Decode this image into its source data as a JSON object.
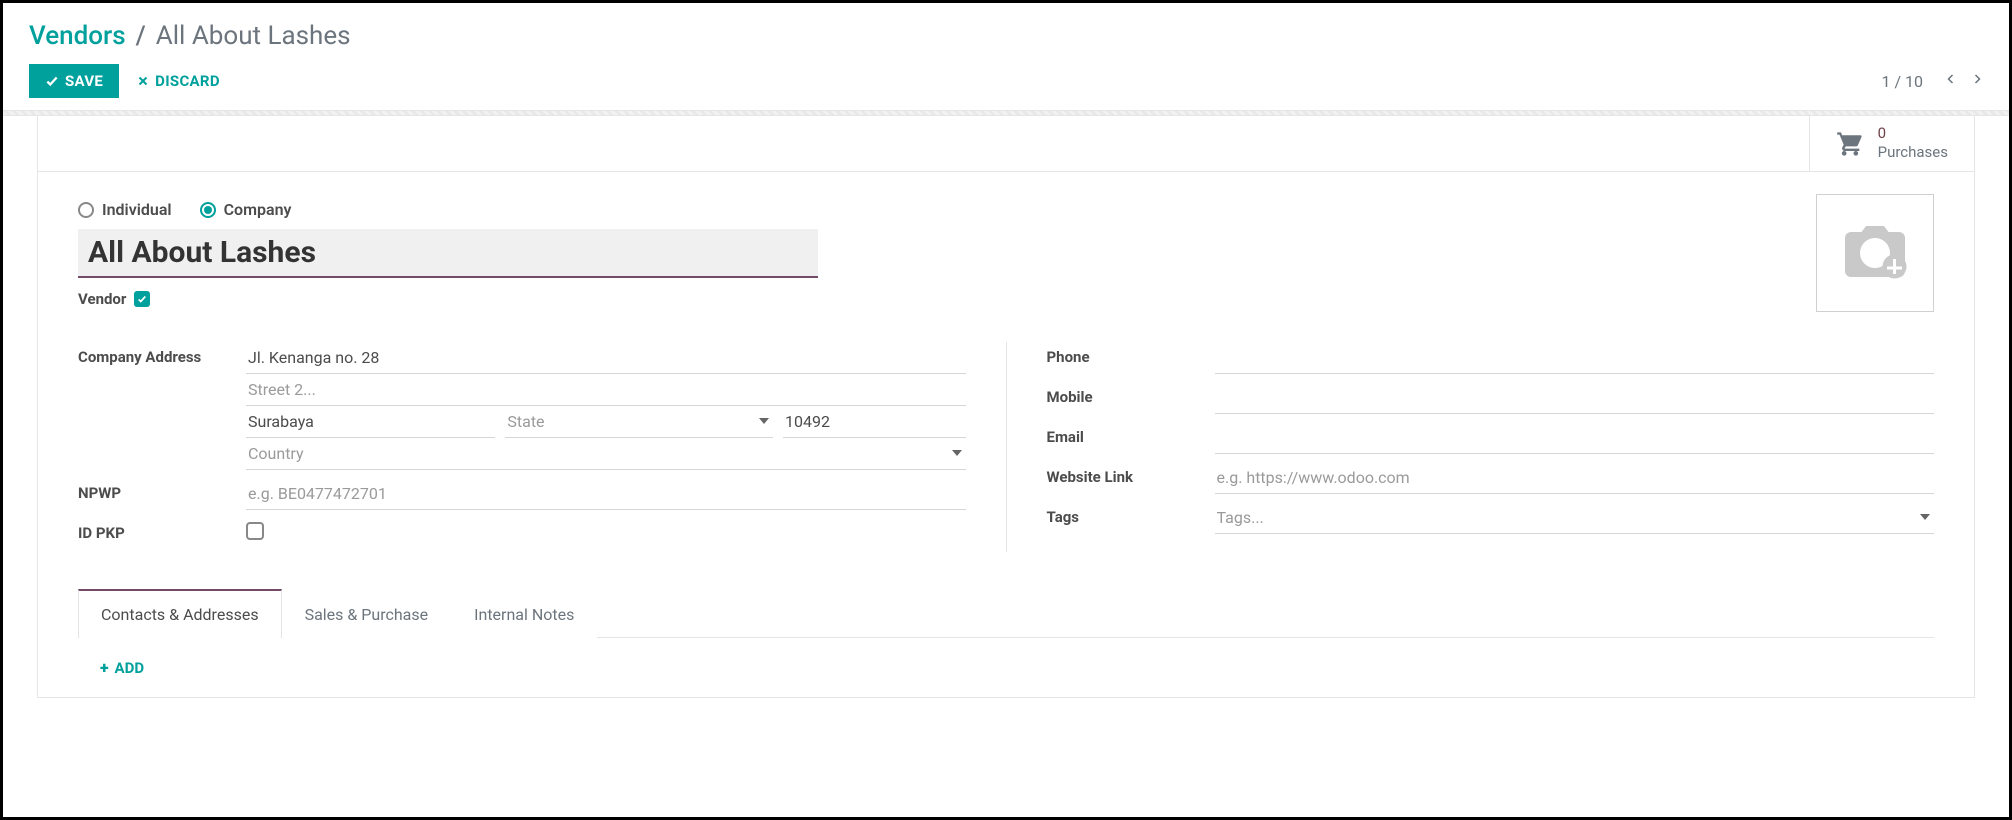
{
  "breadcrumb": {
    "root": "Vendors",
    "current": "All About Lashes"
  },
  "actions": {
    "save": "SAVE",
    "discard": "DISCARD"
  },
  "pager": {
    "position": "1 / 10"
  },
  "statbar": {
    "purchases": {
      "count": "0",
      "label": "Purchases"
    }
  },
  "type_radio": {
    "individual": "Individual",
    "company": "Company"
  },
  "name": "All About Lashes",
  "vendor_label": "Vendor",
  "left_fields": {
    "company_address_label": "Company Address",
    "street": "Jl. Kenanga no. 28",
    "street2_placeholder": "Street 2...",
    "city": "Surabaya",
    "state_placeholder": "State",
    "zip": "10492",
    "country_placeholder": "Country",
    "npwp_label": "NPWP",
    "npwp_placeholder": "e.g. BE0477472701",
    "idpkp_label": "ID PKP"
  },
  "right_fields": {
    "phone_label": "Phone",
    "mobile_label": "Mobile",
    "email_label": "Email",
    "website_label": "Website Link",
    "website_placeholder": "e.g. https://www.odoo.com",
    "tags_label": "Tags",
    "tags_placeholder": "Tags..."
  },
  "tabs": {
    "contacts": "Contacts & Addresses",
    "sales": "Sales & Purchase",
    "notes": "Internal Notes"
  },
  "tab_actions": {
    "add": "ADD"
  }
}
